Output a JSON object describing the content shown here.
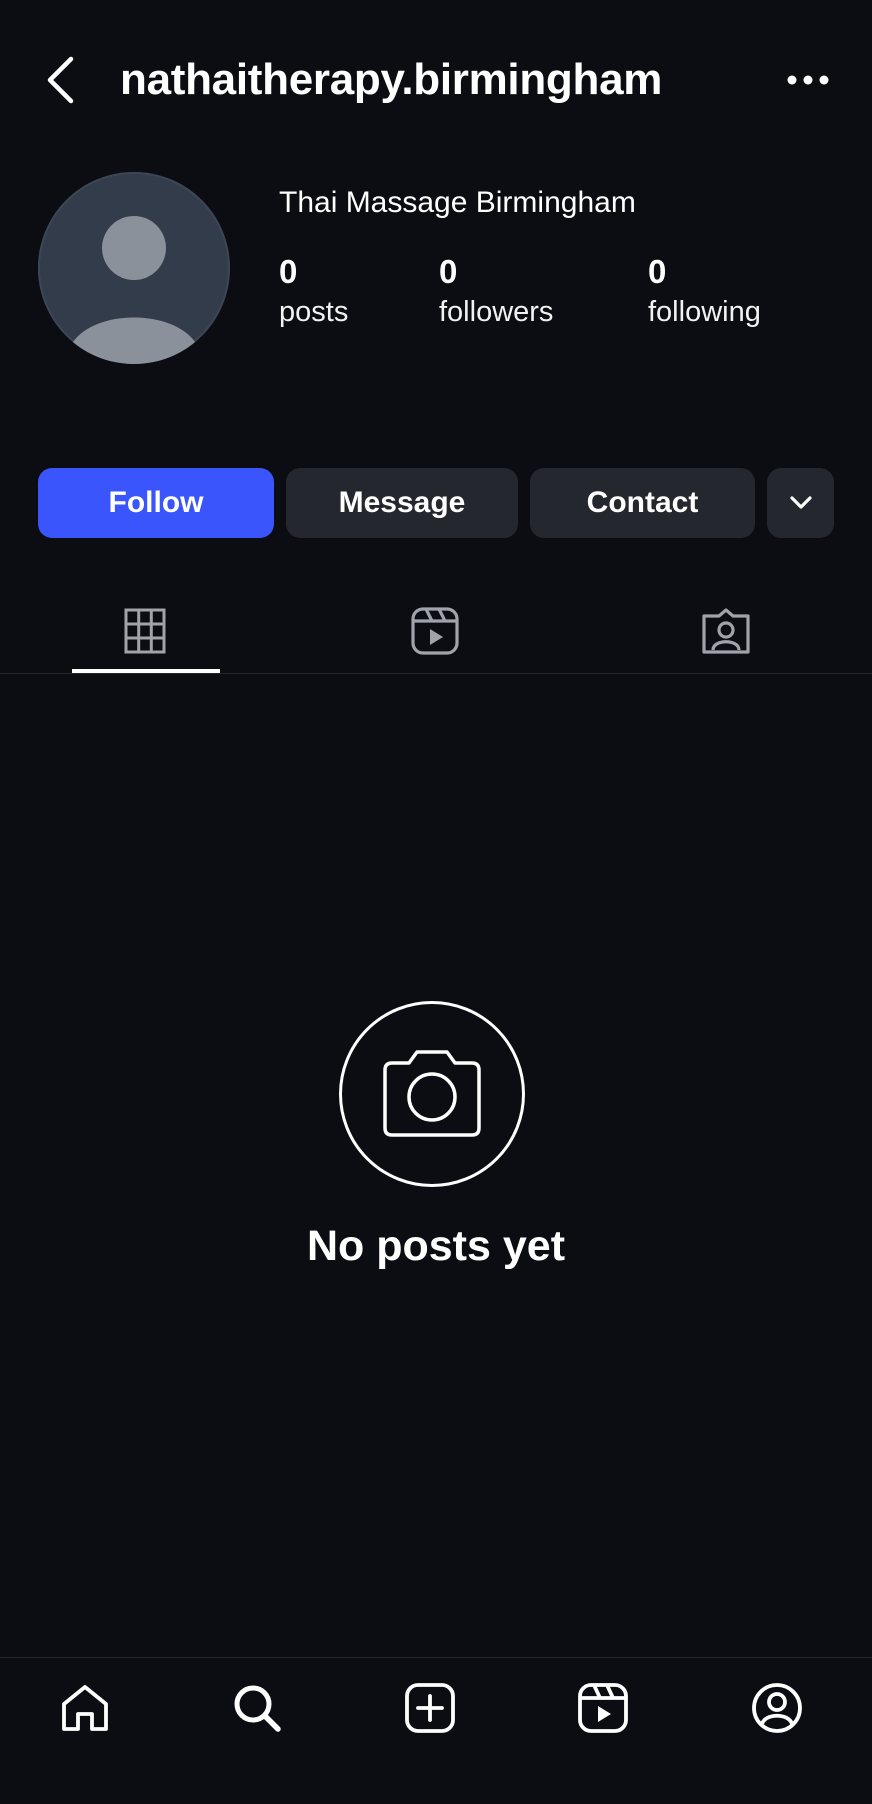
{
  "header": {
    "username": "nathaitherapy.birmingham",
    "back_icon": "chevron-left-icon",
    "more_icon": "ellipsis-horizontal-icon"
  },
  "profile": {
    "display_name": "Thai Massage Birmingham",
    "avatar_icon": "default-avatar-icon",
    "stats": {
      "posts": {
        "value": "0",
        "label": "posts"
      },
      "followers": {
        "value": "0",
        "label": "followers"
      },
      "following": {
        "value": "0",
        "label": "following"
      }
    }
  },
  "actions": {
    "follow_label": "Follow",
    "message_label": "Message",
    "contact_label": "Contact",
    "more_icon": "chevron-down-icon"
  },
  "tabs": [
    {
      "name": "posts",
      "icon": "grid-icon",
      "active": true
    },
    {
      "name": "reels",
      "icon": "reels-icon",
      "active": false
    },
    {
      "name": "tagged",
      "icon": "tagged-icon",
      "active": false
    }
  ],
  "empty_state": {
    "icon": "camera-icon",
    "message": "No posts yet"
  },
  "bottom_nav": [
    {
      "name": "home",
      "icon": "home-icon"
    },
    {
      "name": "search",
      "icon": "search-icon"
    },
    {
      "name": "create",
      "icon": "plus-square-icon"
    },
    {
      "name": "reels",
      "icon": "reels-icon"
    },
    {
      "name": "profile",
      "icon": "profile-icon"
    }
  ],
  "colors": {
    "background": "#0c0d12",
    "primary_button": "#3a55fb",
    "secondary_button": "#24272d",
    "text": "#ffffff",
    "icon_muted": "#a0a3aa"
  }
}
